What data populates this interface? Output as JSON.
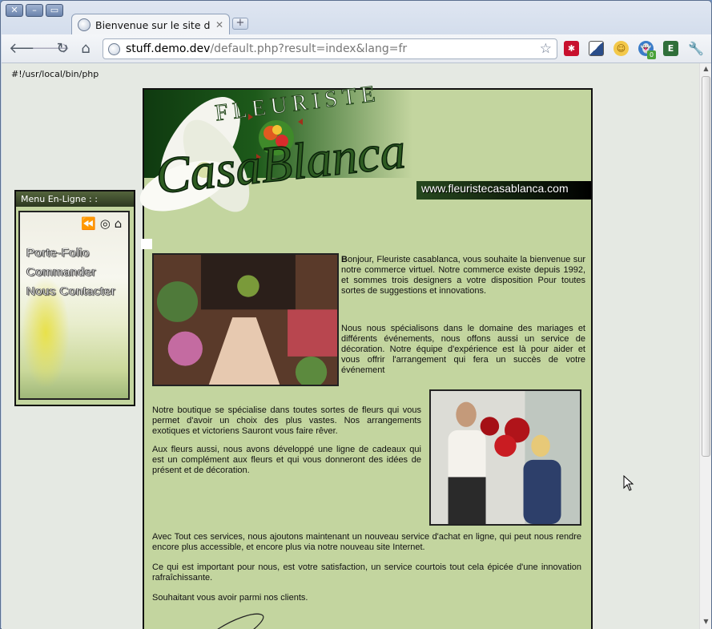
{
  "browser": {
    "tab_title": "Bienvenue sur le site de Fl",
    "url_host": "stuff.demo.dev",
    "url_path": "/default.php?result=index&lang=fr",
    "ext_badge": "0"
  },
  "page": {
    "shebang": "#!/usr/local/bin/php",
    "site_url": "www.fleuristecasablanca.com",
    "logo_top": "FLEURISTE",
    "logo_main": "CasaBlanca",
    "menu": {
      "header": "Menu En-Ligne  : :",
      "items": [
        "Porte-Folio",
        "Commander",
        "Nous Contacter"
      ]
    },
    "intro_initial": "B",
    "intro": "onjour, Fleuriste casablanca, vous souhaite la bienvenue sur notre commerce virtuel. Notre commerce existe depuis 1992, et sommes trois designers a votre disposition Pour toutes sortes de suggestions et innovations.",
    "p2": "Nous nous spécialisons dans le domaine des mariages et différents événements, nous offons aussi un service de décoration. Notre équipe d'expérience est là pour aider et vous offrir l'arrangement qui fera un succès de votre événement",
    "p3": "Notre boutique se spécialise dans toutes sortes de fleurs qui vous permet d'avoir un choix des plus vastes. Nos arrangements exotiques et victoriens Sauront vous faire rêver.",
    "p4": "Aux fleurs aussi, nous avons développé une ligne de cadeaux qui est un complément aux fleurs et qui vous donneront des idées de présent et de décoration.",
    "p5": "Avec Tout ces services, nous ajoutons maintenant un nouveau service d'achat en ligne, qui peut nous rendre encore plus accessible, et encore plus via notre nouveau site Internet.",
    "p6": "Ce qui est important pour nous, est votre satisfaction, un service courtois tout cela épicée d'une innovation rafraîchissante.",
    "p7": "Souhaitant vous avoir parmi nos clients."
  }
}
